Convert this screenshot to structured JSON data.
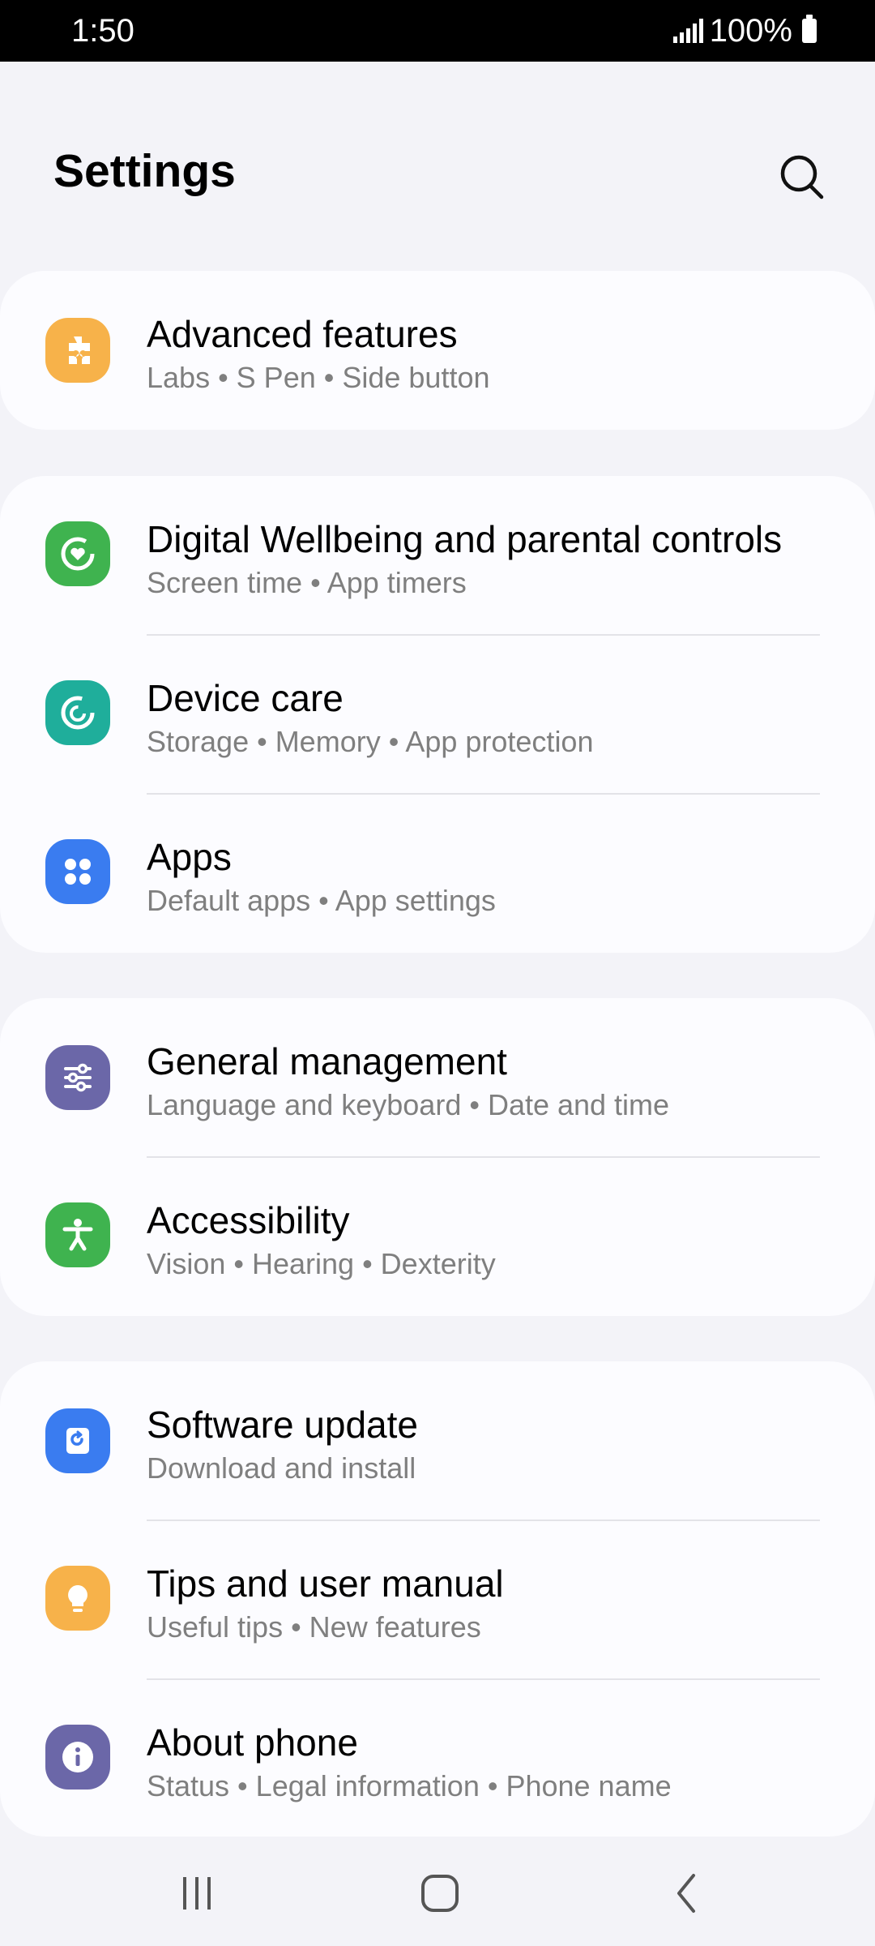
{
  "status_bar": {
    "time": "1:50",
    "battery": "100%"
  },
  "header": {
    "title": "Settings"
  },
  "items": [
    {
      "title": "Advanced features",
      "subtitle": "Labs  •  S Pen  •  Side button",
      "icon": "puzzle-icon",
      "color": "#f7b24a"
    },
    {
      "title": "Digital Wellbeing and parental controls",
      "subtitle": "Screen time  •  App timers",
      "icon": "wellbeing-icon",
      "color": "#3fb34f"
    },
    {
      "title": "Device care",
      "subtitle": "Storage  •  Memory  •  App protection",
      "icon": "device-care-icon",
      "color": "#1fae9b"
    },
    {
      "title": "Apps",
      "subtitle": "Default apps  •  App settings",
      "icon": "apps-grid-icon",
      "color": "#3a7cf0"
    },
    {
      "title": "General management",
      "subtitle": "Language and keyboard  •  Date and time",
      "icon": "sliders-icon",
      "color": "#6b67a8"
    },
    {
      "title": "Accessibility",
      "subtitle": "Vision  •  Hearing  •  Dexterity",
      "icon": "accessibility-icon",
      "color": "#3fb34f"
    },
    {
      "title": "Software update",
      "subtitle": "Download and install",
      "icon": "software-update-icon",
      "color": "#3a7cf0"
    },
    {
      "title": "Tips and user manual",
      "subtitle": "Useful tips  •  New features",
      "icon": "lightbulb-icon",
      "color": "#f7b24a"
    },
    {
      "title": "About phone",
      "subtitle": "Status  •  Legal information  •  Phone name",
      "icon": "info-icon",
      "color": "#6b67a8"
    }
  ],
  "nav_bar": {
    "buttons": [
      "recents-icon",
      "home-icon",
      "back-icon"
    ]
  }
}
